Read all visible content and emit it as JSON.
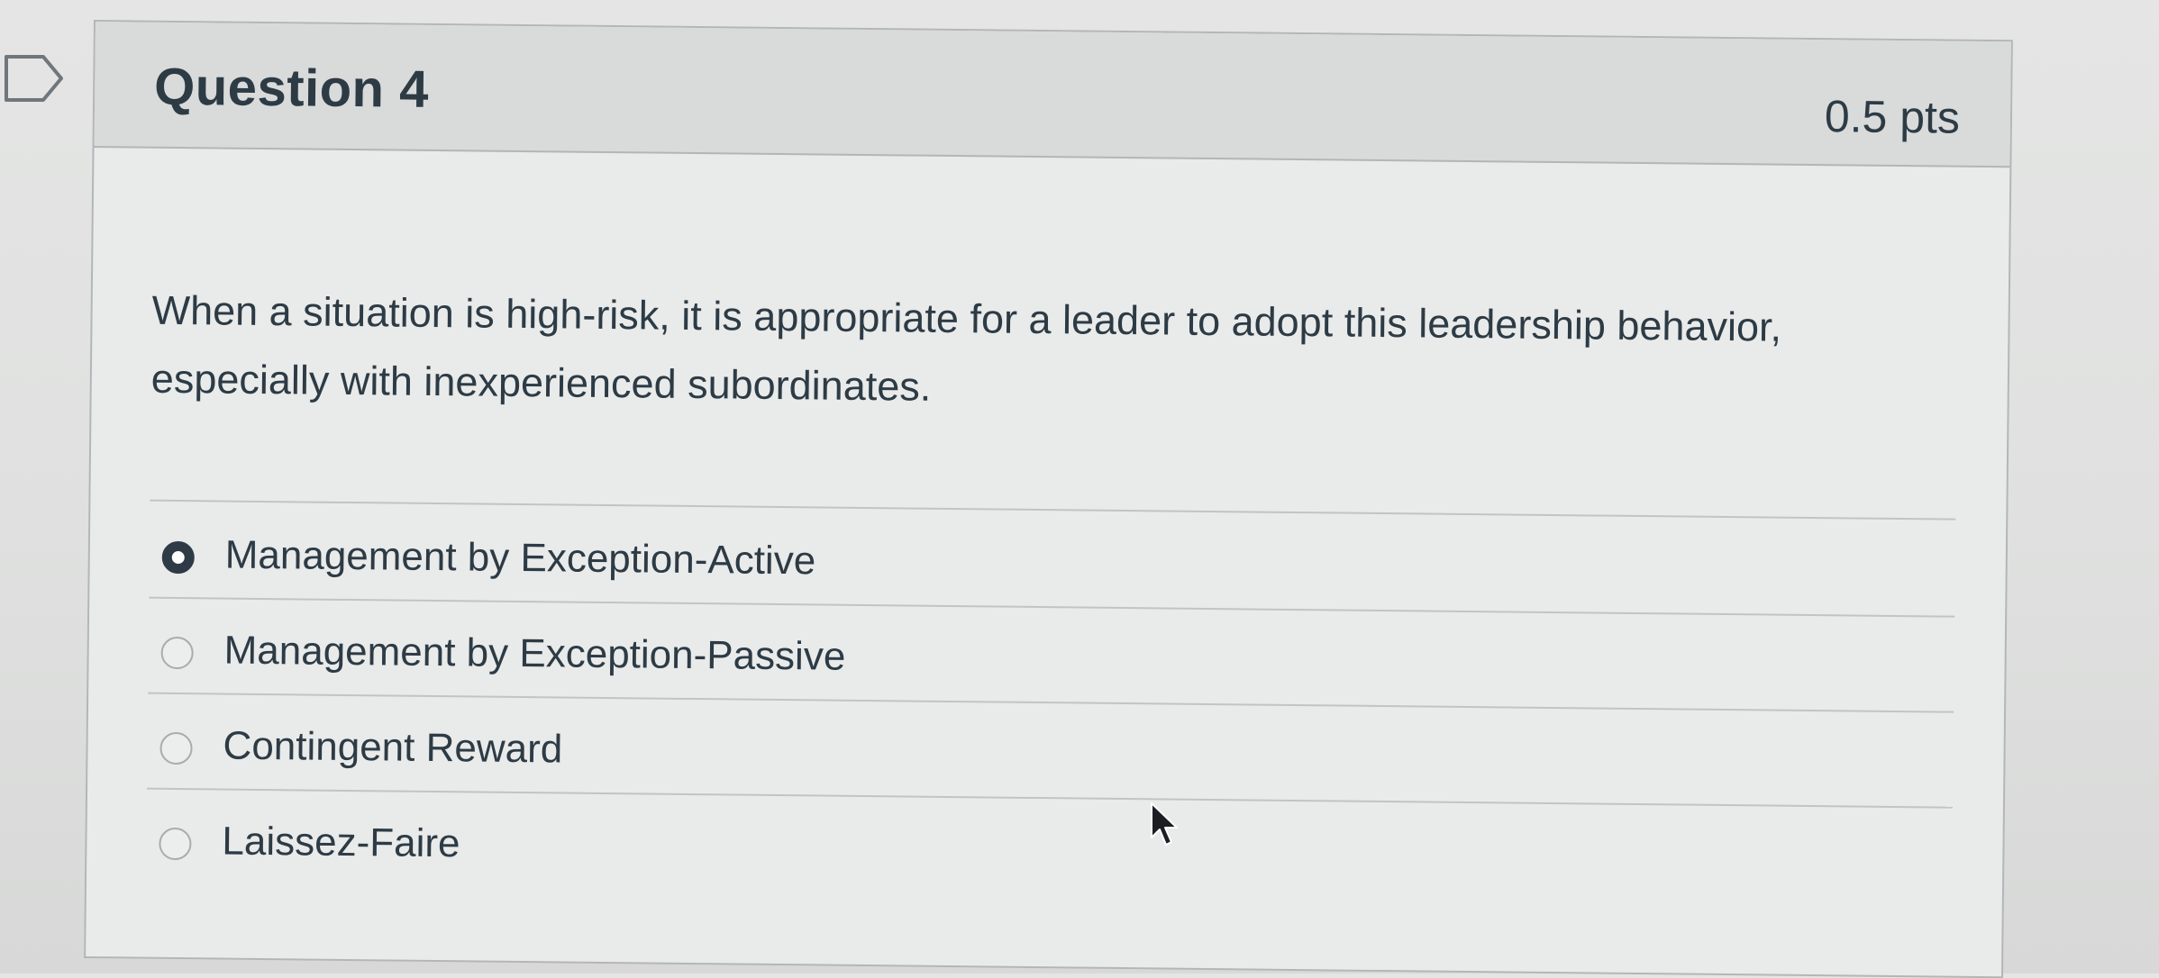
{
  "question": {
    "title": "Question 4",
    "points": "0.5 pts",
    "text": "When a situation is high-risk, it is appropriate for a leader to adopt this leadership behavior, especially with inexperienced subordinates."
  },
  "answers": [
    {
      "label": "Management by Exception-Active",
      "selected": true
    },
    {
      "label": "Management by Exception-Passive",
      "selected": false
    },
    {
      "label": "Contingent Reward",
      "selected": false
    },
    {
      "label": "Laissez-Faire",
      "selected": false
    }
  ],
  "icons": {
    "flag": "bookmark-flag-icon",
    "cursor": "mouse-pointer-icon"
  },
  "colors": {
    "text": "#2d3b45",
    "selected_radio": "#2e3b46",
    "border": "#b3b6b8"
  }
}
